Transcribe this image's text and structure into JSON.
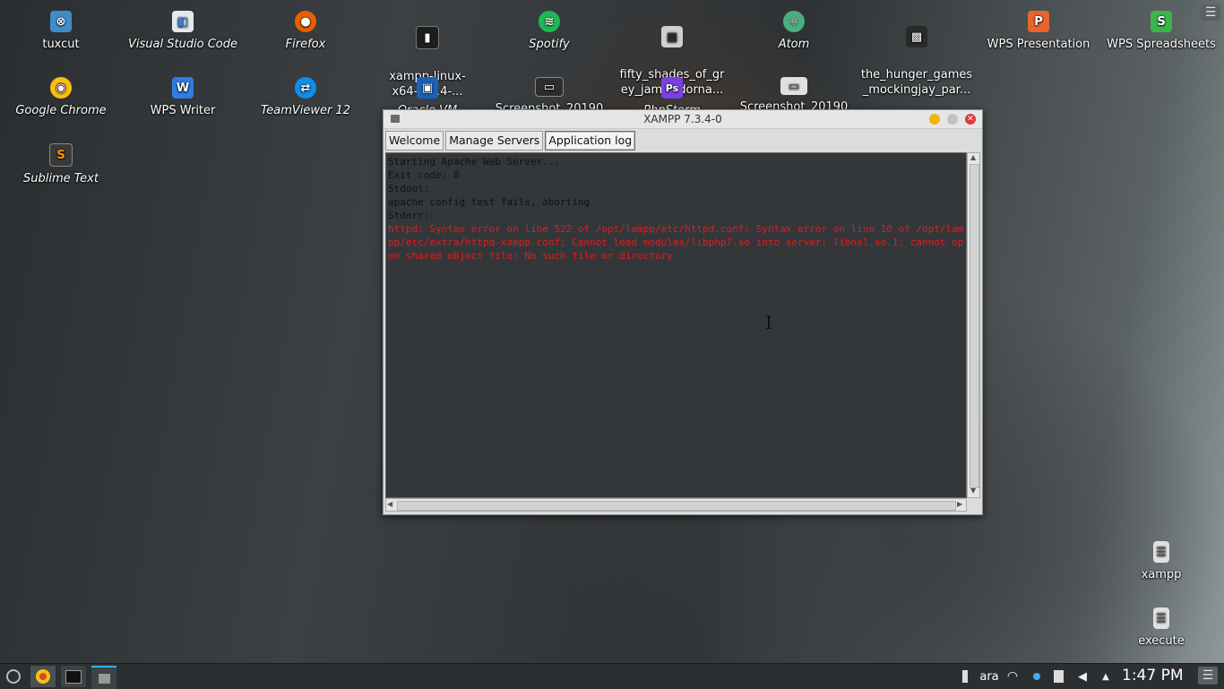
{
  "desktop": {
    "icons": [
      {
        "label": "tuxcut",
        "icon": "tuxcut-icon",
        "color": "#3d8ec9",
        "glyph": "⊗"
      },
      {
        "label": "Visual Studio Code",
        "icon": "vscode-icon",
        "color": "#e8e8e8",
        "glyph": "◧"
      },
      {
        "label": "Firefox",
        "icon": "firefox-icon",
        "color": "#e66000",
        "glyph": "●"
      },
      {
        "label": "xampp-linux-\nx64-7.3.4-...",
        "icon": "executable-icon",
        "color": "#1e1e1e",
        "glyph": "▮"
      },
      {
        "label": "Spotify",
        "icon": "spotify-icon",
        "color": "#1db954",
        "glyph": "≋"
      },
      {
        "label": "fifty_shades_of_gr\ney_jamie_dorna...",
        "icon": "video-file-icon",
        "color": "#cfcfcf",
        "glyph": "▦"
      },
      {
        "label": "Atom",
        "icon": "atom-icon",
        "color": "#4caf7d",
        "glyph": "⚛"
      },
      {
        "label": "the_hunger_games\n_mockingjay_par...",
        "icon": "video-thumb-icon",
        "color": "#2a2a2a",
        "glyph": "▩"
      },
      {
        "label": "WPS Presentation",
        "icon": "wps-presentation-icon",
        "color": "#e8642c",
        "glyph": "P"
      },
      {
        "label": "WPS Spreadsheets",
        "icon": "wps-spreadsheets-icon",
        "color": "#3bb54a",
        "glyph": "S"
      },
      {
        "label": "Google Chrome",
        "icon": "chrome-icon",
        "color": "#db4437",
        "glyph": "◉"
      },
      {
        "label": "WPS Writer",
        "icon": "wps-writer-icon",
        "color": "#2f7de1",
        "glyph": "W"
      },
      {
        "label": "TeamViewer 12",
        "icon": "teamviewer-icon",
        "color": "#0e8ee9",
        "glyph": "⇄"
      },
      {
        "label": "Oracle VM",
        "icon": "virtualbox-icon",
        "color": "#1a62b8",
        "glyph": "▣"
      },
      {
        "label": "Screenshot_20190",
        "icon": "screenshot-file-icon",
        "color": "#2d2d2d",
        "glyph": "▭"
      },
      {
        "label": "PhpStorm",
        "icon": "phpstorm-icon",
        "color": "#7b3fe4",
        "glyph": "Ps"
      },
      {
        "label": "Screenshot_20190",
        "icon": "screenshot-file-icon-2",
        "color": "#e0e0e0",
        "glyph": "▭"
      },
      {
        "label": "Sublime Text",
        "icon": "sublime-text-icon",
        "color": "#3a3a3a",
        "glyph": "S"
      },
      {
        "label": "xampp",
        "icon": "document-file-icon",
        "color": "#e0e0e0",
        "glyph": "☰"
      },
      {
        "label": "execute",
        "icon": "document-file-icon-2",
        "color": "#e0e0e0",
        "glyph": "☰"
      }
    ]
  },
  "window": {
    "title": "XAMPP 7.3.4-0",
    "tabs": [
      "Welcome",
      "Manage Servers",
      "Application log"
    ],
    "active_tab": "Application log",
    "log": {
      "line1": "Starting Apache Web Server...",
      "line2": "Exit code: 8",
      "line3": "Stdout:",
      "line4": "apache config test fails, aborting",
      "line5": "Stderr:",
      "error": "httpd: Syntax error on line 522 of /opt/lampp/etc/httpd.conf: Syntax error on line 10 of /opt/lampp/etc/extra/httpd-xampp.conf: Cannot load modules/libphp7.so into server: libnsl.so.1: cannot open shared object file: No such file or directory"
    },
    "close_glyph": "✕"
  },
  "taskbar": {
    "keyboard_layout": "ara",
    "clock": "1:47 PM",
    "menu_glyph": "☰"
  },
  "colors": {
    "error_text": "#e21c1c",
    "log_background": "#33373a"
  }
}
